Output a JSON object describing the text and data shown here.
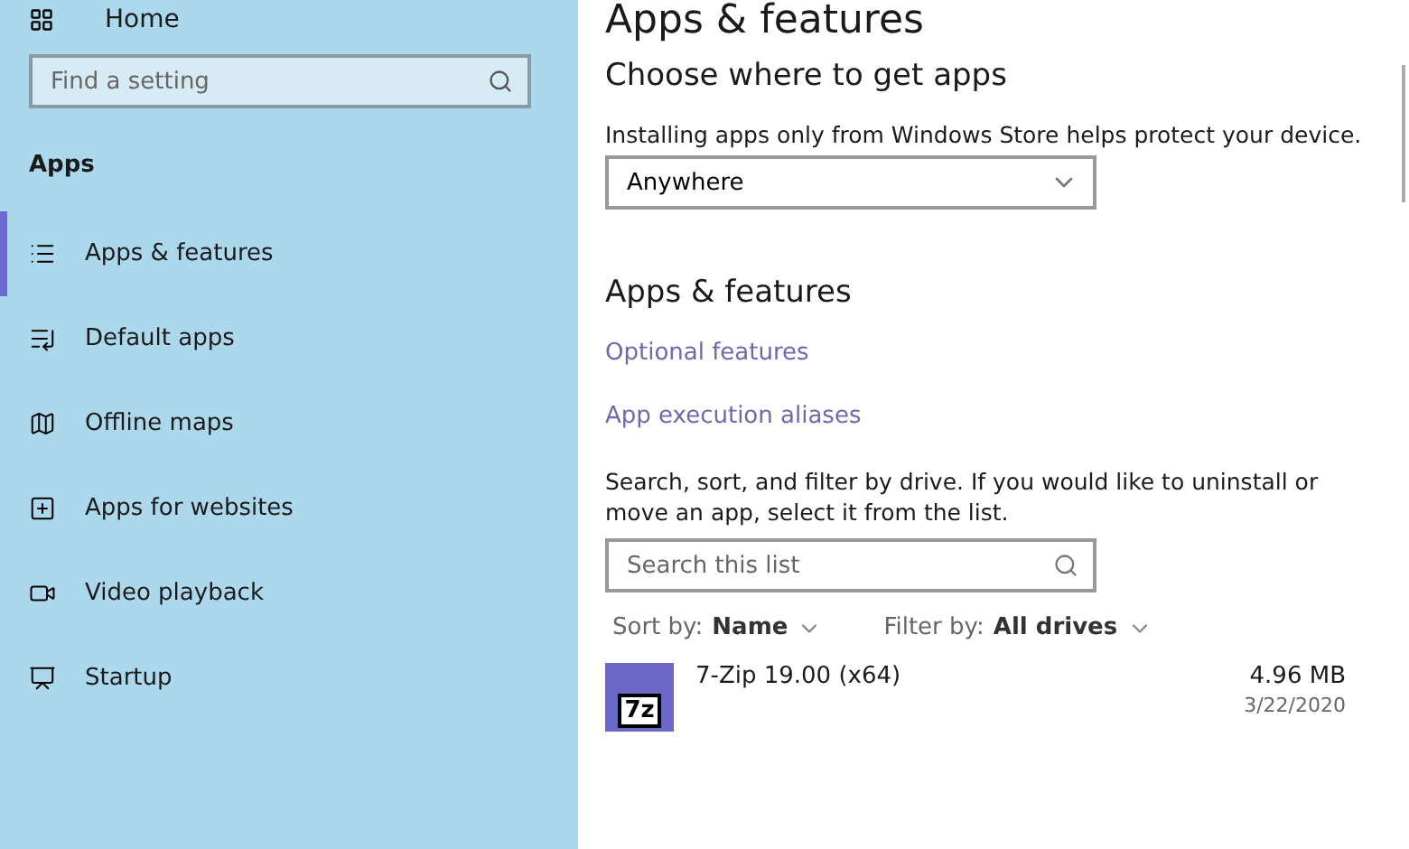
{
  "sidebar": {
    "home": "Home",
    "search": {
      "placeholder": "Find a setting"
    },
    "section": "Apps",
    "items": [
      {
        "label": "Apps & features",
        "selected": true
      },
      {
        "label": "Default apps",
        "selected": false
      },
      {
        "label": "Offline maps",
        "selected": false
      },
      {
        "label": "Apps for websites",
        "selected": false
      },
      {
        "label": "Video playback",
        "selected": false
      },
      {
        "label": "Startup",
        "selected": false
      }
    ]
  },
  "main": {
    "title": "Apps & features",
    "choose": {
      "heading": "Choose where to get apps",
      "description": "Installing apps only from Windows Store helps protect your device.",
      "dropdown": "Anywhere"
    },
    "apps": {
      "heading": "Apps & features",
      "links": [
        "Optional features",
        "App execution aliases"
      ],
      "description": "Search, sort, and filter by drive. If you would like to uninstall or move an app, select it from the list.",
      "search": {
        "placeholder": "Search this list"
      },
      "sort": {
        "label": "Sort by:",
        "value": "Name"
      },
      "filter": {
        "label": "Filter by:",
        "value": "All drives"
      },
      "list": [
        {
          "name": "7-Zip 19.00 (x64)",
          "icon_text": "7z",
          "size": "4.96 MB",
          "date": "3/22/2020"
        }
      ]
    }
  }
}
